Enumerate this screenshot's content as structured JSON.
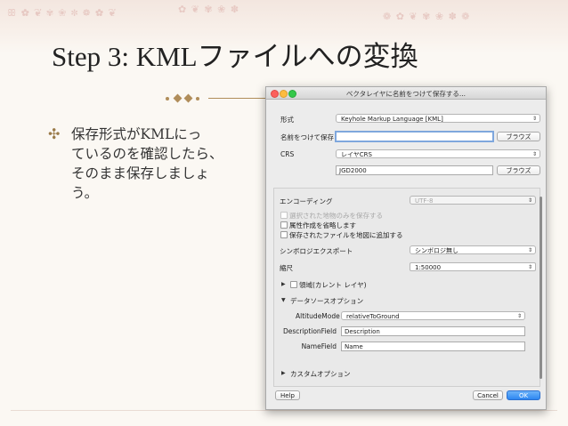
{
  "slide": {
    "title": "Step 3: KMLファイルへの変換",
    "bullet": "保存形式がKMLにっ\nているのを確認したら、\nそのまま保存しましょ\nう。",
    "bullet_mark": "✣"
  },
  "dialog": {
    "title": "ベクタレイヤに名前をつけて保存する...",
    "format_label": "形式",
    "format_value": "Keyhole Markup Language [KML]",
    "saveas_label": "名前をつけて保存",
    "saveas_value": "",
    "browse_label": "ブラウズ",
    "crs_label": "CRS",
    "crs_value": "レイヤCRS",
    "crs_name": "JGD2000",
    "encoding_label": "エンコーディング",
    "encoding_value": "UTF-8",
    "opt_selected_only": "選択された地物のみを保存する",
    "opt_skip_attr": "属性作成を省略します",
    "opt_add_to_map": "保存されたファイルを地図に追加する",
    "symbology_label": "シンボロジエクスポート",
    "symbology_value": "シンボロジ無し",
    "scale_label": "縮尺",
    "scale_value": "1:50000",
    "extent_label": "領域(カレント レイヤ)",
    "datasource_label": "データソースオプション",
    "altitude_label": "AltitudeMode",
    "altitude_value": "relativeToGround",
    "description_label": "DescriptionField",
    "description_value": "Description",
    "namefield_label": "NameField",
    "namefield_value": "Name",
    "custom_label": "カスタムオプション",
    "help_label": "Help",
    "cancel_label": "Cancel",
    "ok_label": "OK"
  },
  "colors": {
    "ok": "#2d87f1",
    "accent": "#b08d5a"
  }
}
